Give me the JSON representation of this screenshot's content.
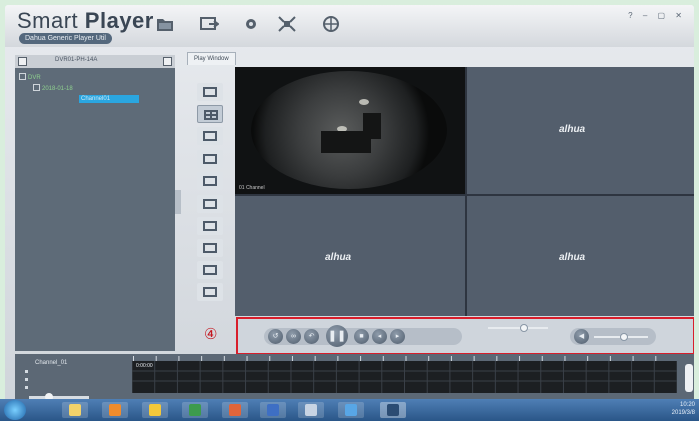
{
  "app": {
    "title_light": "Smart ",
    "title_bold": "Player",
    "subtitle": "Dahua Generic Player Util"
  },
  "window_controls": "? – ▢ ✕",
  "device_panel": {
    "header": "DVR01-PH-14A",
    "tree": [
      {
        "label": "DVR",
        "level": 0
      },
      {
        "label": "2018-01-18",
        "level": 1
      },
      {
        "label": "Channel01",
        "level": 2,
        "selected": true
      }
    ]
  },
  "play_tab": "Play Window",
  "video_panes": {
    "brand_logo": "alhua",
    "live_stamp": "01 Channel"
  },
  "annotation_number": "④",
  "controls": {
    "buttons_group1": [
      "↺",
      "∞",
      "↶"
    ],
    "pause": "❚❚",
    "buttons_group2": [
      "■",
      "◂",
      "▸"
    ],
    "speed_slider_value": 0.6,
    "volume_icon": "◀",
    "volume_value": 0.55
  },
  "timeline": {
    "channel_label": "Channel_01",
    "track_tag": "0:00:00",
    "hours": [
      "0",
      "1",
      "2",
      "3",
      "4",
      "5",
      "6",
      "7",
      "8",
      "9",
      "10",
      "11",
      "12",
      "13",
      "14",
      "15",
      "16",
      "17",
      "18",
      "19",
      "20",
      "21",
      "22",
      "23",
      "24"
    ]
  },
  "taskbar": {
    "time": "10:20",
    "date": "2019/3/8"
  }
}
